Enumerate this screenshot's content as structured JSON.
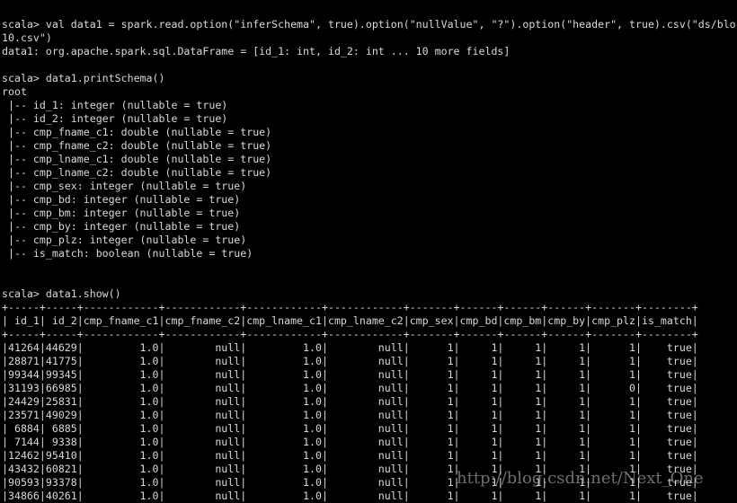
{
  "terminal": {
    "lines": [
      "scala> val data1 = spark.read.option(\"inferSchema\", true).option(\"nullValue\", \"?\").option(\"header\", true).csv(\"ds/blo",
      "10.csv\")",
      "data1: org.apache.spark.sql.DataFrame = [id_1: int, id_2: int ... 10 more fields]",
      "",
      "scala> data1.printSchema()",
      "root",
      " |-- id_1: integer (nullable = true)",
      " |-- id_2: integer (nullable = true)",
      " |-- cmp_fname_c1: double (nullable = true)",
      " |-- cmp_fname_c2: double (nullable = true)",
      " |-- cmp_lname_c1: double (nullable = true)",
      " |-- cmp_lname_c2: double (nullable = true)",
      " |-- cmp_sex: integer (nullable = true)",
      " |-- cmp_bd: integer (nullable = true)",
      " |-- cmp_bm: integer (nullable = true)",
      " |-- cmp_by: integer (nullable = true)",
      " |-- cmp_plz: integer (nullable = true)",
      " |-- is_match: boolean (nullable = true)",
      "",
      "",
      "scala> data1.show()"
    ],
    "table": {
      "columns": [
        "id_1",
        "id_2",
        "cmp_fname_c1",
        "cmp_fname_c2",
        "cmp_lname_c1",
        "cmp_lname_c2",
        "cmp_sex",
        "cmp_bd",
        "cmp_bm",
        "cmp_by",
        "cmp_plz",
        "is_match"
      ],
      "widths": [
        5,
        5,
        12,
        12,
        12,
        12,
        7,
        6,
        6,
        6,
        7,
        8
      ],
      "rows": [
        [
          "41264",
          "44629",
          "1.0",
          "null",
          "1.0",
          "null",
          "1",
          "1",
          "1",
          "1",
          "1",
          "true"
        ],
        [
          "28871",
          "41775",
          "1.0",
          "null",
          "1.0",
          "null",
          "1",
          "1",
          "1",
          "1",
          "1",
          "true"
        ],
        [
          "99344",
          "99345",
          "1.0",
          "null",
          "1.0",
          "null",
          "1",
          "1",
          "1",
          "1",
          "1",
          "true"
        ],
        [
          "31193",
          "66985",
          "1.0",
          "null",
          "1.0",
          "null",
          "1",
          "1",
          "1",
          "1",
          "0",
          "true"
        ],
        [
          "24429",
          "25831",
          "1.0",
          "null",
          "1.0",
          "null",
          "1",
          "1",
          "1",
          "1",
          "1",
          "true"
        ],
        [
          "23571",
          "49029",
          "1.0",
          "null",
          "1.0",
          "null",
          "1",
          "1",
          "1",
          "1",
          "1",
          "true"
        ],
        [
          "6884",
          "6885",
          "1.0",
          "null",
          "1.0",
          "null",
          "1",
          "1",
          "1",
          "1",
          "1",
          "true"
        ],
        [
          "7144",
          "9338",
          "1.0",
          "null",
          "1.0",
          "null",
          "1",
          "1",
          "1",
          "1",
          "1",
          "true"
        ],
        [
          "12462",
          "95410",
          "1.0",
          "null",
          "1.0",
          "null",
          "1",
          "1",
          "1",
          "1",
          "1",
          "true"
        ],
        [
          "43432",
          "60821",
          "1.0",
          "null",
          "1.0",
          "null",
          "1",
          "1",
          "1",
          "1",
          "1",
          "true"
        ],
        [
          "90593",
          "93378",
          "1.0",
          "null",
          "1.0",
          "null",
          "1",
          "1",
          "1",
          "1",
          "1",
          "true"
        ],
        [
          "34866",
          "40261",
          "1.0",
          "null",
          "1.0",
          "null",
          "1",
          "1",
          "1",
          "1",
          "1",
          "true"
        ]
      ]
    }
  },
  "watermark": "http://blog.csdn.net/Next_One",
  "colors": {
    "background": "#000000",
    "text": "#d9d9d9"
  }
}
